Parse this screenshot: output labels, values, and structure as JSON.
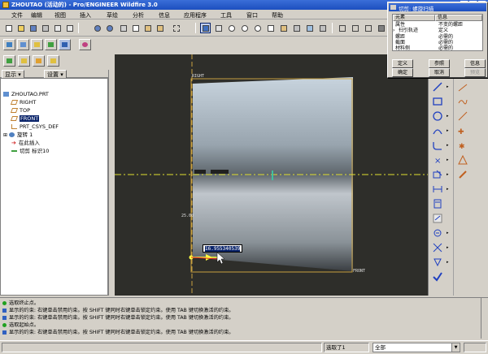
{
  "window": {
    "title": "ZHOUTAO (活动的) - Pro/ENGINEER Wildfire 3.0",
    "controls": [
      "_",
      "□",
      "×"
    ]
  },
  "menu": [
    "文件",
    "编辑",
    "视图",
    "插入",
    "草绘",
    "分析",
    "信息",
    "应用程序",
    "工具",
    "窗口",
    "帮助"
  ],
  "left_panel": {
    "show_label": "显示",
    "settings_label": "设置",
    "tree_items": [
      {
        "label": "ZHOUTAO.PRT",
        "icon": "part-icon",
        "selected": false
      },
      {
        "label": "RIGHT",
        "icon": "datum-plane-icon",
        "selected": false
      },
      {
        "label": "TOP",
        "icon": "datum-plane-icon",
        "selected": false
      },
      {
        "label": "FRONT",
        "icon": "datum-plane-icon",
        "selected": true
      },
      {
        "label": "PRT_CSYS_DEF",
        "icon": "csys-icon",
        "selected": false
      },
      {
        "label": "旋转 1",
        "icon": "revolve-icon",
        "selected": false
      },
      {
        "label": "在此插入",
        "icon": "insert-here-icon",
        "selected": false
      },
      {
        "label": "切剪 标识10",
        "icon": "cut-icon",
        "selected": false
      }
    ]
  },
  "viewport": {
    "plane_labels": {
      "right": "RIGHT",
      "front": "FRONT"
    },
    "dim_value": "16.955340539",
    "dim_small": "25.00"
  },
  "dialog": {
    "title": "切剪: 螺旋扫描",
    "columns": [
      "元素",
      "信息"
    ],
    "rows": [
      {
        "element": "属性",
        "info": "不变的螺距"
      },
      {
        "element": "扫引轨迹",
        "info": "定义"
      },
      {
        "element": "螺距",
        "info": "必需的"
      },
      {
        "element": "截面",
        "info": "必需的"
      },
      {
        "element": "材料侧",
        "info": "必需的"
      }
    ],
    "buttons": {
      "define": "定义",
      "reference": "参照",
      "info": "信息",
      "ok": "确定",
      "cancel": "取消",
      "preview": "预览"
    }
  },
  "messages": [
    {
      "text": "选取终止点。",
      "icon": "arrow-icon"
    },
    {
      "text": "显示的约束: 右键单击禁用约束。按 SHIFT 键同时右键单击锁定约束。使用 TAB 键切换激活的约束。",
      "icon": "bullet-icon"
    },
    {
      "text": "显示的约束: 右键单击禁用约束。按 SHIFT 键同时右键单击锁定约束。使用 TAB 键切换激活的约束。",
      "icon": "bullet-icon"
    },
    {
      "text": "选取起始点。",
      "icon": "arrow-icon"
    },
    {
      "text": "显示的约束: 右键单击禁用约束。按 SHIFT 键同时右键单击锁定约束。使用 TAB 键切换激活的约束。",
      "icon": "bullet-icon"
    }
  ],
  "status": {
    "selected": "选取了1",
    "filter": "全部"
  },
  "colors": {
    "titlebar": "#1c4fbf",
    "viewport_bg": "#2e2e2a",
    "datum": "#c8a040",
    "centerline": "#e0e030",
    "selected": "#0a246a"
  }
}
